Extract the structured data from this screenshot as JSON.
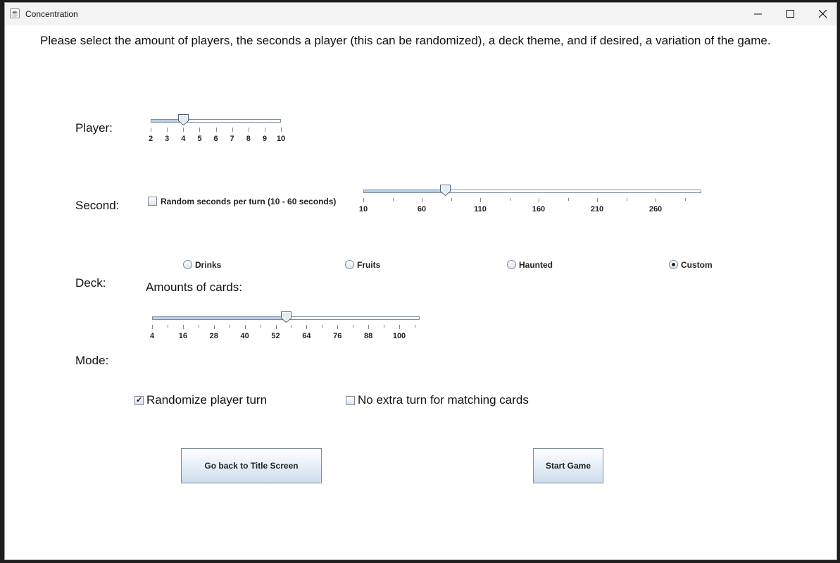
{
  "window": {
    "title": "Concentration"
  },
  "instruction": "Please select the amount of players, the seconds a player (this can be randomized), a deck theme, and if desired, a variation of the game.",
  "labels": {
    "player": "Player:",
    "second": "Second:",
    "deck": "Deck:",
    "mode": "Mode:",
    "amounts_of_cards": "Amounts of cards:"
  },
  "player_slider": {
    "min": 2,
    "max": 10,
    "value": 4,
    "labels": [
      "2",
      "3",
      "4",
      "5",
      "6",
      "7",
      "8",
      "9",
      "10"
    ]
  },
  "seconds": {
    "random_checkbox_label": "Random seconds per turn (10 - 60 seconds)",
    "random_checked": false,
    "slider": {
      "min": 10,
      "max": 300,
      "value": 80,
      "labels": [
        "10",
        "60",
        "110",
        "160",
        "210",
        "260"
      ]
    }
  },
  "deck": {
    "options": [
      {
        "label": "Drinks",
        "selected": false
      },
      {
        "label": "Fruits",
        "selected": false
      },
      {
        "label": "Haunted",
        "selected": false
      },
      {
        "label": "Custom",
        "selected": true
      }
    ]
  },
  "cards_slider": {
    "min": 4,
    "max": 112,
    "value": 56,
    "labels": [
      "4",
      "16",
      "28",
      "40",
      "52",
      "64",
      "76",
      "88",
      "100"
    ]
  },
  "mode": {
    "randomize_label": "Randomize player turn",
    "randomize_checked": true,
    "no_extra_label": "No extra turn for matching cards",
    "no_extra_checked": false
  },
  "buttons": {
    "back": "Go back to Title Screen",
    "start": "Start Game"
  }
}
